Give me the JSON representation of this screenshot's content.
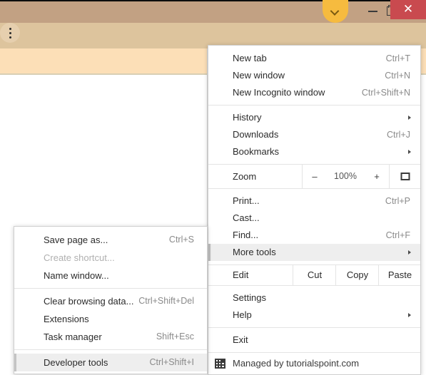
{
  "window": {
    "titlebar": {
      "tab_chevron_icon": "chevron-down-icon",
      "minimize_label": "–",
      "maximize_label": "❐",
      "close_label": "✕"
    },
    "toolbar": {
      "icons": [
        {
          "name": "share-icon"
        },
        {
          "name": "bookmark-star-icon"
        },
        {
          "name": "extensions-puzzle-icon"
        },
        {
          "name": "side-panel-icon"
        },
        {
          "name": "chrome-menu-icon"
        }
      ]
    }
  },
  "colors": {
    "titlebar": "#c2a183",
    "toolbar": "#ddc49d",
    "omnibox": "#e6cfae",
    "page_strip": "#fcdfb7",
    "close_button": "#c94a4f",
    "tab_chevron": "#f6bb3f",
    "menu_background": "#ffffff",
    "menu_highlight": "#eeeeee",
    "menu_border": "#cfcfcf",
    "separator": "#e4e4e4",
    "text": "#2b2b2b",
    "accel_text": "#8a8a8a",
    "disabled_text": "#b0b0b0"
  },
  "chrome_menu": {
    "groups": [
      {
        "items": [
          {
            "label": "New tab",
            "accel": "Ctrl+T",
            "submenu": false,
            "selected": false
          },
          {
            "label": "New window",
            "accel": "Ctrl+N",
            "submenu": false,
            "selected": false
          },
          {
            "label": "New Incognito window",
            "accel": "Ctrl+Shift+N",
            "submenu": false,
            "selected": false
          }
        ]
      },
      {
        "items": [
          {
            "label": "History",
            "accel": "",
            "submenu": true,
            "selected": false
          },
          {
            "label": "Downloads",
            "accel": "Ctrl+J",
            "submenu": false,
            "selected": false
          },
          {
            "label": "Bookmarks",
            "accel": "",
            "submenu": true,
            "selected": false
          }
        ]
      }
    ],
    "zoom_row": {
      "label": "Zoom",
      "minus_label": "–",
      "value": "100%",
      "plus_label": "+",
      "fullscreen_icon": "fullscreen-icon"
    },
    "group3": {
      "items": [
        {
          "label": "Print...",
          "accel": "Ctrl+P",
          "submenu": false,
          "selected": false
        },
        {
          "label": "Cast...",
          "accel": "",
          "submenu": false,
          "selected": false
        },
        {
          "label": "Find...",
          "accel": "Ctrl+F",
          "submenu": false,
          "selected": false
        },
        {
          "label": "More tools",
          "accel": "",
          "submenu": true,
          "selected": true
        }
      ]
    },
    "edit_row": {
      "label": "Edit",
      "cut_label": "Cut",
      "copy_label": "Copy",
      "paste_label": "Paste"
    },
    "group4": {
      "items": [
        {
          "label": "Settings",
          "accel": "",
          "submenu": false,
          "selected": false
        },
        {
          "label": "Help",
          "accel": "",
          "submenu": true,
          "selected": false
        }
      ]
    },
    "group5": {
      "items": [
        {
          "label": "Exit",
          "accel": "",
          "submenu": false,
          "selected": false
        }
      ]
    },
    "managed": {
      "icon": "enterprise-building-icon",
      "text": "Managed by tutorialspoint.com"
    }
  },
  "more_tools_submenu": {
    "groups": [
      {
        "items": [
          {
            "label": "Save page as...",
            "accel": "Ctrl+S",
            "disabled": false,
            "selected": false
          },
          {
            "label": "Create shortcut...",
            "accel": "",
            "disabled": true,
            "selected": false
          },
          {
            "label": "Name window...",
            "accel": "",
            "disabled": false,
            "selected": false
          }
        ]
      },
      {
        "items": [
          {
            "label": "Clear browsing data...",
            "accel": "Ctrl+Shift+Del",
            "disabled": false,
            "selected": false
          },
          {
            "label": "Extensions",
            "accel": "",
            "disabled": false,
            "selected": false
          },
          {
            "label": "Task manager",
            "accel": "Shift+Esc",
            "disabled": false,
            "selected": false
          }
        ]
      },
      {
        "items": [
          {
            "label": "Developer tools",
            "accel": "Ctrl+Shift+I",
            "disabled": false,
            "selected": true
          }
        ]
      }
    ]
  }
}
